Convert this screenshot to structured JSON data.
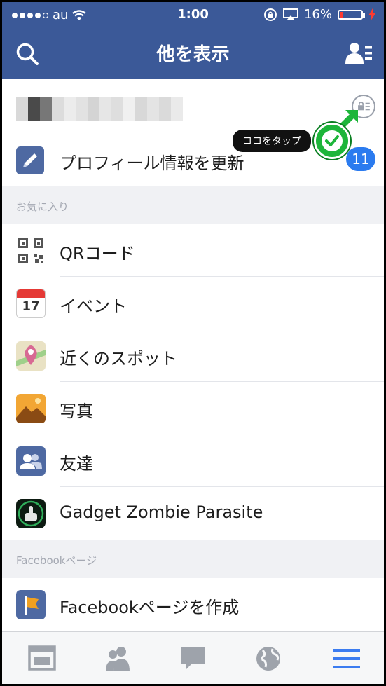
{
  "status_bar": {
    "carrier": "au",
    "time": "1:00",
    "battery": "16%"
  },
  "header": {
    "title": "他を表示",
    "search_icon": "search-icon",
    "friends_icon": "friend-requests-icon"
  },
  "profile": {
    "privacy_icon": "privacy-shortcuts-icon",
    "tooltip": "ココをタップ",
    "tap_marker_icon": "check-icon"
  },
  "update_profile": {
    "label": "プロフィール情報を更新",
    "badge": "11",
    "icon": "pencil-icon"
  },
  "sections": {
    "favorites": "お気に入り",
    "facebook_pages": "Facebookページ"
  },
  "favorites": [
    {
      "label": "QRコード",
      "icon": "qr-code-icon"
    },
    {
      "label": "イベント",
      "icon": "calendar-icon",
      "icon_text": "17"
    },
    {
      "label": "近くのスポット",
      "icon": "map-pin-icon"
    },
    {
      "label": "写真",
      "icon": "photo-icon"
    },
    {
      "label": "友達",
      "icon": "friends-icon"
    },
    {
      "label": "Gadget Zombie Parasite",
      "icon": "app-icon"
    }
  ],
  "pages": [
    {
      "label": "Facebookページを作成",
      "icon": "create-page-icon"
    }
  ],
  "tab_bar": [
    "news-feed-icon",
    "friends-tab-icon",
    "messages-icon",
    "notifications-globe-icon",
    "more-menu-icon"
  ],
  "colors": {
    "brand": "#3b5998",
    "badge": "#2b7bef",
    "tap_marker": "#1db53a",
    "active_tab": "#3b7cf0"
  }
}
